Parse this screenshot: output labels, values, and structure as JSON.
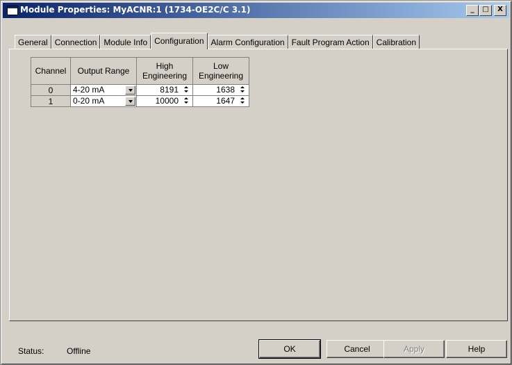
{
  "window": {
    "title": "Module Properties: MyACNR:1 (1734-OE2C/C 3.1)"
  },
  "titlebar_buttons": {
    "minimize": "_",
    "maximize": "□",
    "close": "X"
  },
  "tabs": [
    {
      "label": "General",
      "active": false
    },
    {
      "label": "Connection",
      "active": false
    },
    {
      "label": "Module Info",
      "active": false
    },
    {
      "label": "Configuration",
      "active": true
    },
    {
      "label": "Alarm Configuration",
      "active": false
    },
    {
      "label": "Fault Program Action",
      "active": false
    },
    {
      "label": "Calibration",
      "active": false
    }
  ],
  "grid": {
    "headers": [
      "Channel",
      "Output Range",
      "High Engineering",
      "Low Engineering"
    ],
    "rows": [
      {
        "channel": "0",
        "output_range": "4-20 mA",
        "high": "8191",
        "low": "1638"
      },
      {
        "channel": "1",
        "output_range": "0-20 mA",
        "high": "10000",
        "low": "1647"
      }
    ]
  },
  "status": {
    "label": "Status:",
    "value": "Offline"
  },
  "buttons": {
    "ok": "OK",
    "cancel": "Cancel",
    "apply": "Apply",
    "help": "Help"
  }
}
